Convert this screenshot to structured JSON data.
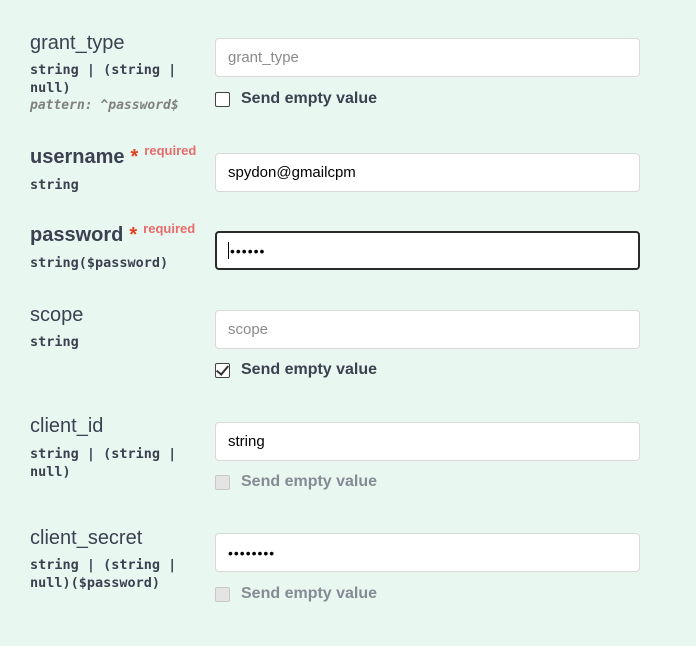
{
  "params": {
    "grant_type": {
      "name": "grant_type",
      "type": "string | (string |\nnull)",
      "pattern": "pattern: ^password$",
      "placeholder": "grant_type",
      "send_empty_label": "Send empty value",
      "send_empty_checked": false
    },
    "username": {
      "name": "username",
      "star": "*",
      "required_label": "required",
      "type": "string",
      "value": "spydon@gmailcpm"
    },
    "password": {
      "name": "password",
      "star": "*",
      "required_label": "required",
      "type": "string($password)",
      "value": "••••••"
    },
    "scope": {
      "name": "scope",
      "type": "string",
      "placeholder": "scope",
      "send_empty_label": "Send empty value",
      "send_empty_checked": true
    },
    "client_id": {
      "name": "client_id",
      "type": "string | (string |\nnull)",
      "value": "string",
      "send_empty_label": "Send empty value",
      "send_empty_disabled": true
    },
    "client_secret": {
      "name": "client_secret",
      "type": "string | (string |\nnull)($password)",
      "value": "••••••••",
      "send_empty_label": "Send empty value",
      "send_empty_disabled": true
    }
  },
  "colors": {
    "background": "#e8f8f1",
    "required_star": "#e2401c",
    "required_label": "#e76b6b",
    "text": "#3b4151"
  }
}
